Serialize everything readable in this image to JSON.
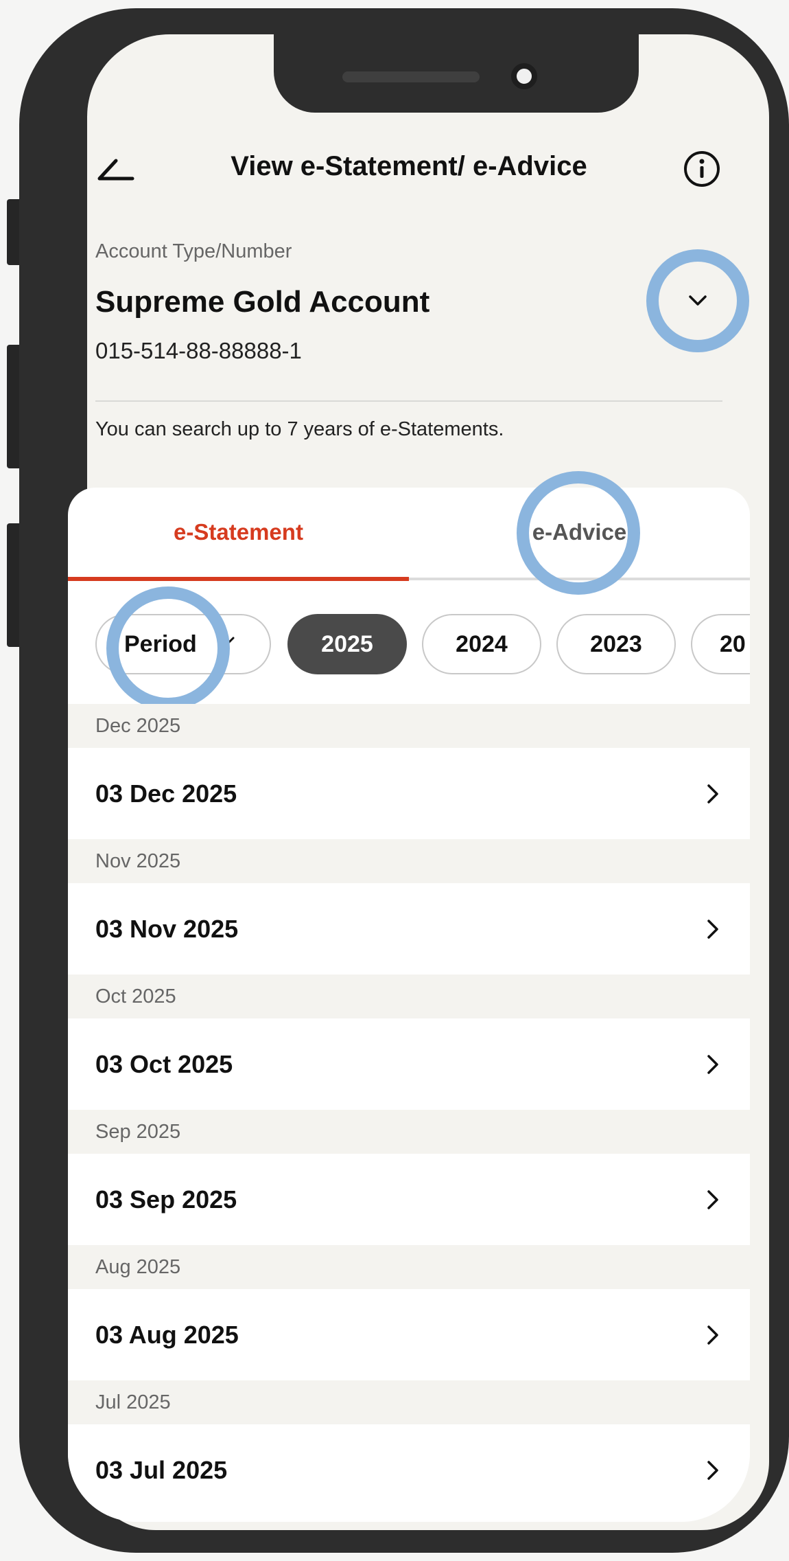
{
  "header": {
    "title": "View e-Statement/ e-Advice",
    "back_icon": "back-arrow-icon",
    "info_icon": "info-icon"
  },
  "account": {
    "label": "Account Type/Number",
    "name": "Supreme Gold Account",
    "number": "015-514-88-88888-1",
    "dropdown_icon": "chevron-down-icon"
  },
  "search_note": "You can search up to 7 years of e-Statements.",
  "tabs": [
    {
      "label": "e-Statement",
      "active": true
    },
    {
      "label": "e-Advice",
      "active": false
    }
  ],
  "filters": {
    "period_label": "Period",
    "years": [
      "2025",
      "2024",
      "2023",
      "20"
    ],
    "selected_year": "2025"
  },
  "statements": [
    {
      "month": "Dec 2025",
      "date": "03 Dec 2025"
    },
    {
      "month": "Nov 2025",
      "date": "03 Nov 2025"
    },
    {
      "month": "Oct 2025",
      "date": "03 Oct 2025"
    },
    {
      "month": "Sep 2025",
      "date": "03 Sep 2025"
    },
    {
      "month": "Aug 2025",
      "date": "03 Aug 2025"
    },
    {
      "month": "Jul 2025",
      "date": "03 Jul 2025"
    }
  ],
  "colors": {
    "accent": "#d63b1f",
    "highlight_ring": "#8bb5de",
    "chip_selected": "#4a4a4a",
    "tab_inactive_underline": "#dcdcdc"
  }
}
